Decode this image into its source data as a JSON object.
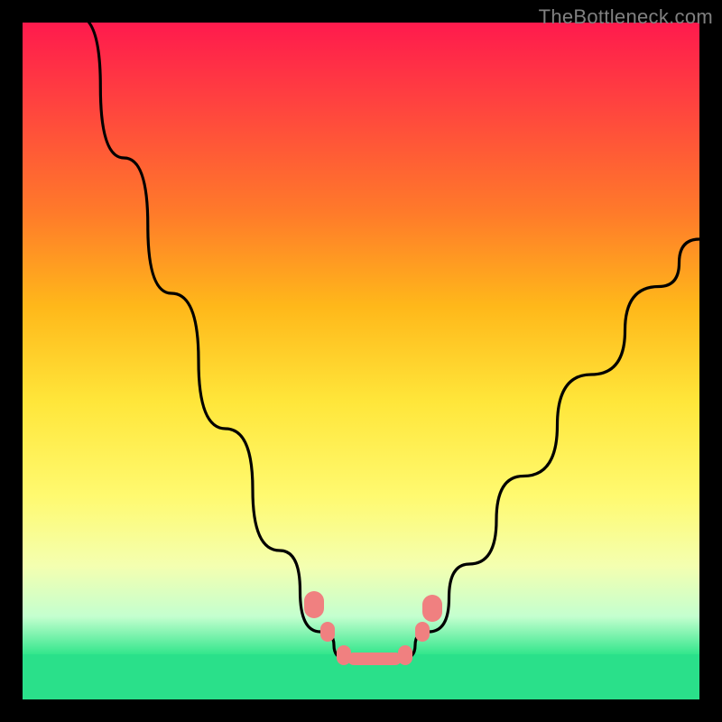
{
  "watermark": "TheBottleneck.com",
  "colors": {
    "frame_bg": "#000000",
    "gradient_top": "#ff1a4d",
    "gradient_bottom": "#33e68c",
    "green_bar": "#2ae08a",
    "curve": "#000000",
    "marker": "#f08080"
  },
  "chart_data": {
    "type": "line",
    "title": "",
    "xlabel": "",
    "ylabel": "",
    "xlim": [
      0,
      100
    ],
    "ylim": [
      0,
      100
    ],
    "curve_left": [
      {
        "x": 8,
        "y": 101
      },
      {
        "x": 15,
        "y": 80
      },
      {
        "x": 22,
        "y": 60
      },
      {
        "x": 30,
        "y": 40
      },
      {
        "x": 38,
        "y": 22
      },
      {
        "x": 44,
        "y": 10
      },
      {
        "x": 48,
        "y": 6
      }
    ],
    "curve_right": [
      {
        "x": 56,
        "y": 6
      },
      {
        "x": 60,
        "y": 10
      },
      {
        "x": 66,
        "y": 20
      },
      {
        "x": 74,
        "y": 33
      },
      {
        "x": 84,
        "y": 48
      },
      {
        "x": 94,
        "y": 61
      },
      {
        "x": 100,
        "y": 68
      }
    ],
    "valley_floor_y": 6,
    "valley_start_x": 48,
    "valley_end_x": 56,
    "markers": [
      {
        "x": 43.0,
        "y": 14.0,
        "style": "normal"
      },
      {
        "x": 45.0,
        "y": 10.0,
        "style": "small"
      },
      {
        "x": 47.5,
        "y": 6.5,
        "style": "small"
      },
      {
        "x": 52.0,
        "y": 6.0,
        "style": "hbar"
      },
      {
        "x": 56.5,
        "y": 6.5,
        "style": "small"
      },
      {
        "x": 59.0,
        "y": 10.0,
        "style": "small"
      },
      {
        "x": 60.5,
        "y": 13.5,
        "style": "normal"
      }
    ]
  }
}
